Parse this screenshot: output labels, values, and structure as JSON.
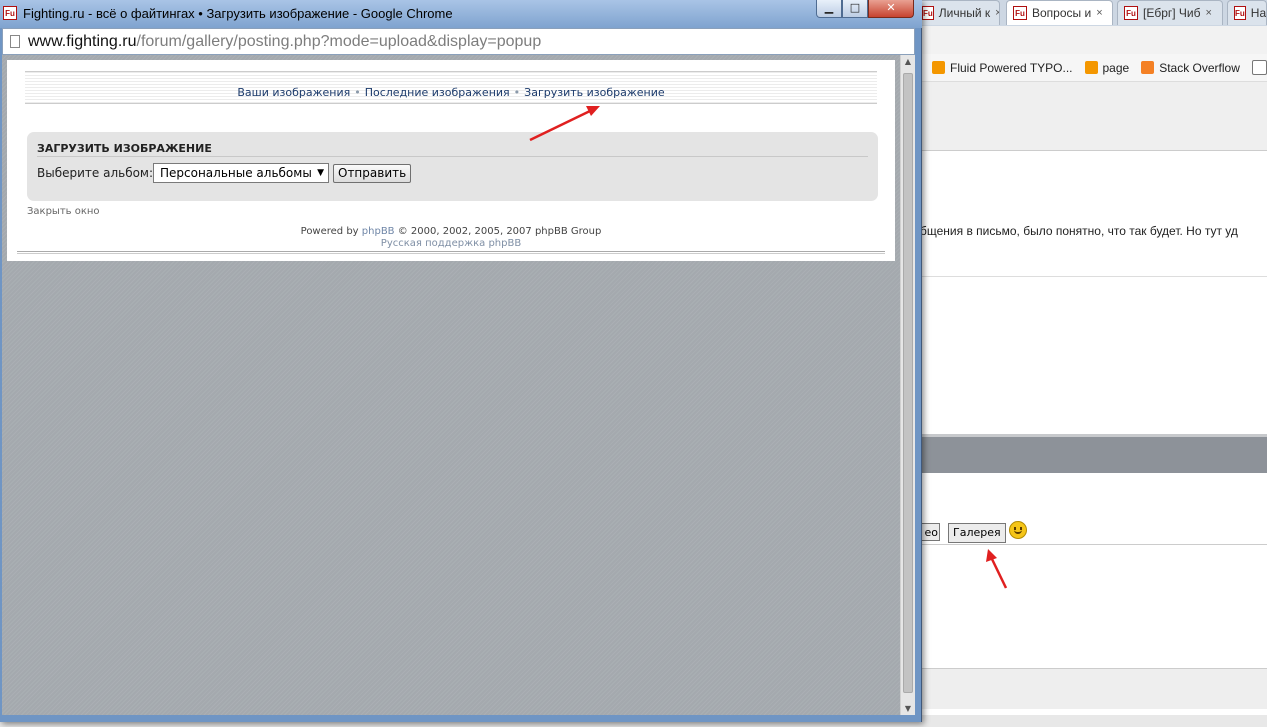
{
  "colors": {
    "annotation_arrow": "#e02020",
    "link": "#1b3a6b",
    "panel_bg": "#e4e4e4",
    "titlebar": "#8aaad3",
    "viewport_bg": "#a4a9ae"
  },
  "background_window": {
    "tabs": [
      {
        "label": "Личный к",
        "icon": "fighting-favicon"
      },
      {
        "label": "Вопросы и",
        "icon": "fighting-favicon",
        "active": true
      },
      {
        "label": "[Ебрг] Чиб",
        "icon": "fighting-favicon"
      },
      {
        "label": "На",
        "icon": "fighting-favicon"
      }
    ],
    "tab_close": "×",
    "bookmarks": [
      {
        "label": "Fluid Powered TYPO...",
        "icon": "typo3-icon"
      },
      {
        "label": "page",
        "icon": "typo3-icon"
      },
      {
        "label": "Stack Overflow",
        "icon": "stackoverflow-icon"
      }
    ],
    "message_fragment": "бщения в письмо, было понятно, что так будет. Но тут уд",
    "video_button_fragment": "ео",
    "gallery_button": "Галерея"
  },
  "popup": {
    "window_title": "Fighting.ru - всё о файтингах • Загрузить изображение - Google Chrome",
    "window_buttons": {
      "minimize": "▁",
      "maximize": "□",
      "close": "✕"
    },
    "favicon_text": "Fu",
    "url": {
      "host": "www.fighting.ru",
      "path": "/forum/gallery/posting.php?mode=upload&display=popup"
    },
    "nav": {
      "links": [
        "Ваши изображения",
        "Последние изображения",
        "Загрузить изображение"
      ],
      "separator": "•"
    },
    "upload_panel": {
      "title": "Загрузить изображение",
      "album_label": "Выберите альбом:",
      "album_selected": "Персональные альбомы",
      "dropdown_arrow": "▼",
      "submit_label": "Отправить"
    },
    "close_window": "Закрыть окно",
    "footer": {
      "powered_prefix": "Powered by ",
      "powered_link": "phpBB",
      "powered_suffix": " © 2000, 2002, 2005, 2007 phpBB Group",
      "support": "Русская поддержка phpBB"
    },
    "scroll_up": "▲",
    "scroll_down": "▼"
  }
}
